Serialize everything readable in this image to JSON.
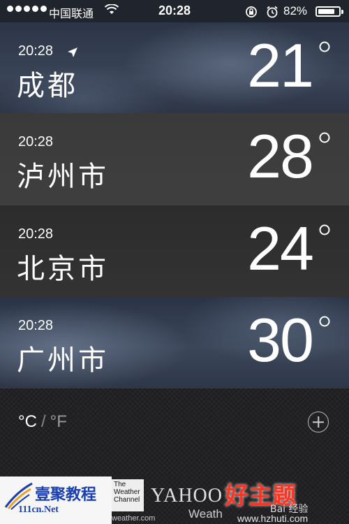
{
  "status_bar": {
    "carrier": "中国联通",
    "time": "20:28",
    "battery": "82%",
    "battery_level": 0.82
  },
  "cities": [
    {
      "time": "20:28",
      "name": "成都",
      "temp": "21",
      "current_location": true
    },
    {
      "time": "20:28",
      "name": "泸州市",
      "temp": "28",
      "current_location": false
    },
    {
      "time": "20:28",
      "name": "北京市",
      "temp": "24",
      "current_location": false
    },
    {
      "time": "20:28",
      "name": "广州市",
      "temp": "30",
      "current_location": false
    }
  ],
  "units": {
    "celsius": "°C",
    "separator": "/",
    "fahrenheit": "°F",
    "selected": "celsius"
  },
  "logos": {
    "yiju_cn": "壹聚教程",
    "yiju_url": "111cn.Net",
    "twc": [
      "The",
      "Weather",
      "Channel"
    ],
    "twc_url": "weather.com",
    "yahoo": "YAHOO",
    "yahoo_sub": "Weath",
    "hzt": "好主题",
    "baidu": "Bai 经验",
    "hzt_url": "www.hzhuti.com"
  },
  "colors": {
    "accent": "#ffffff",
    "bottom_bg": "#1e1e20",
    "watermark_red": "#ff3322"
  }
}
